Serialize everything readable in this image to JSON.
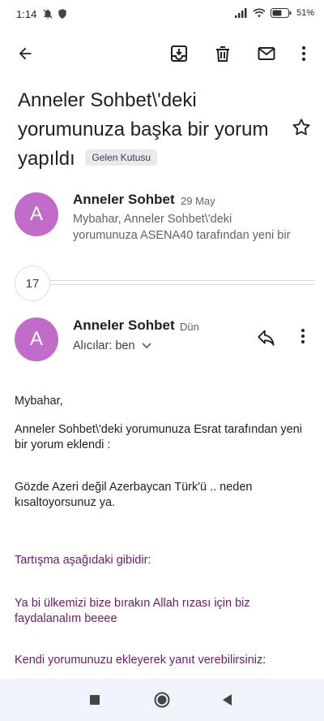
{
  "status": {
    "time": "1:14",
    "battery": "51%"
  },
  "subject": {
    "text": "Anneler Sohbet\\'deki yorumunuza başka bir yorum yapıldı",
    "label": "Gelen Kutusu"
  },
  "collapsed_message": {
    "avatar_letter": "A",
    "sender": "Anneler Sohbet",
    "date": "29 May",
    "snippet_line1": "Mybahar, Anneler Sohbet\\'deki",
    "snippet_line2": "yorumunuza ASENA40 tarafından yeni bir"
  },
  "thread_count": "17",
  "open_message": {
    "avatar_letter": "A",
    "sender": "Anneler Sohbet",
    "date": "Dün",
    "recipients": "Alıcılar: ben",
    "body": {
      "greeting": "Mybahar,",
      "line1": "Anneler Sohbet\\'deki yorumunuza Esrat tarafından yeni bir yorum eklendi :",
      "comment": "Gözde Azeri değil Azerbaycan Türk'ü .. neden kısaltoyorsunuz ya.",
      "discussion_label": "Tartışma aşağıdaki gibidir:",
      "quote": "Ya bi ülkemizi bize bırakın Allah rızası için biz faydalanalım beeee",
      "reply_prompt": "Kendi yorumunuzu ekleyerek yanıt verebilirsiniz:"
    }
  },
  "icons": {
    "back": "arrow-left-icon",
    "archive": "archive-icon",
    "delete": "trash-icon",
    "mark_unread": "mail-icon",
    "more": "more-vert-icon",
    "star": "star-outline-icon",
    "reply": "reply-icon",
    "nav_recent": "square-icon",
    "nav_home": "circle-icon",
    "nav_back": "triangle-back-icon"
  },
  "colors": {
    "avatar": "#c26cc9",
    "link_text": "#6a1b6a",
    "nav_bg": "#f1f3fa"
  }
}
